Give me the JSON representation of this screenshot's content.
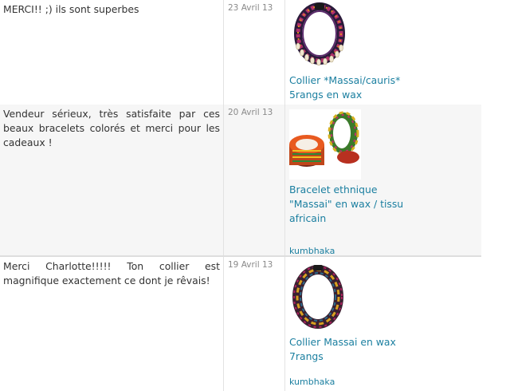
{
  "reviews": [
    {
      "comment": "MERCI!! ;) ils sont superbes",
      "date": "23 Avril 13",
      "product": {
        "title": "Collier *Massai/cauris* 5rangs en wax",
        "shop": "",
        "image_icon": "necklace-cowrie-photo"
      }
    },
    {
      "comment": "Vendeur sérieux, très satisfaite par ces beaux bracelets colorés et merci pour les cadeaux !",
      "date": "20 Avril 13",
      "product": {
        "title": "Bracelet ethnique \"Massai\" en wax / tissu africain",
        "shop": "kumbhaka",
        "image_icon": "bracelets-photo"
      }
    },
    {
      "comment": "Merci Charlotte!!!!! Ton collier est magnifique exactement ce dont je rêvais!",
      "date": "19 Avril 13",
      "product": {
        "title": "Collier Massai en wax 7rangs",
        "shop": "kumbhaka",
        "image_icon": "necklace-photo"
      }
    }
  ],
  "colors": {
    "link": "#1b7fa0",
    "date": "#8a8a8a",
    "text": "#333333",
    "alt_row": "#f6f6f6"
  }
}
